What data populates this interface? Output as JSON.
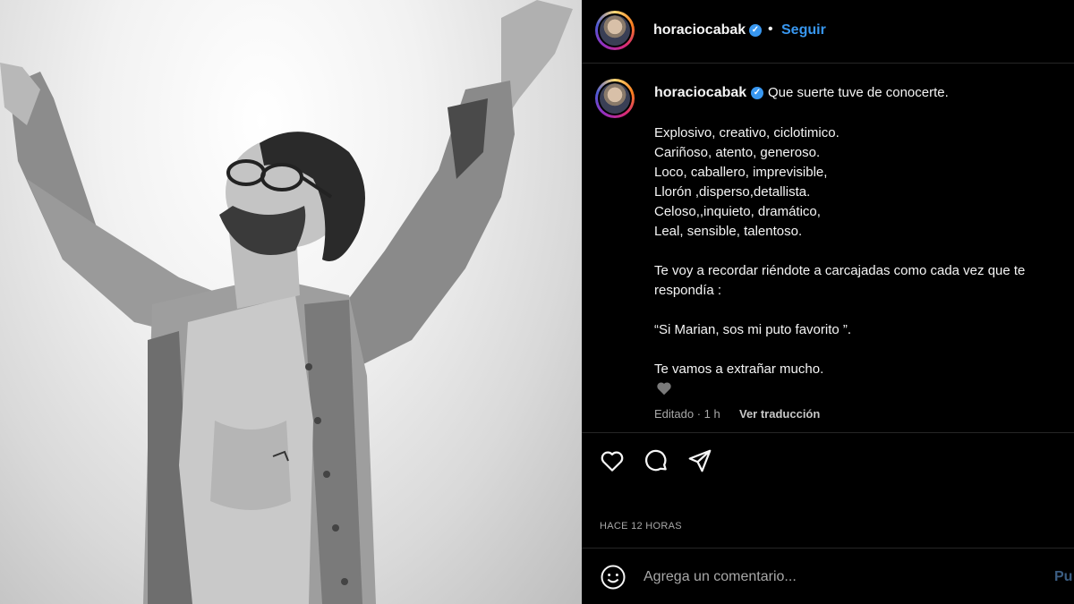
{
  "header": {
    "username": "horaciocabak",
    "dot": "•",
    "follow_label": "Seguir"
  },
  "caption": {
    "username": "horaciocabak",
    "first_line": "Que suerte tuve de conocerte.",
    "lines": [
      "Explosivo, creativo, ciclotimico.",
      "Cariñoso, atento, generoso.",
      "Loco, caballero, imprevisible,",
      "Llorón ,disperso,detallista.",
      "Celoso,,inquieto, dramático,",
      "Leal, sensible, talentoso.",
      "Te voy a recordar riéndote a carcajadas como cada vez que te",
      "respondía :",
      "“Si Marian, sos mi puto favorito ”.",
      "Te vamos a extrañar mucho."
    ],
    "edited": "Editado · 1 h",
    "see_translation": "Ver traducción"
  },
  "post": {
    "timestamp": "HACE 12 HORAS"
  },
  "comment": {
    "placeholder": "Agrega un comentario...",
    "publish_label": "Pu"
  },
  "colors": {
    "accent": "#3897f0",
    "background": "#000000",
    "text": "#f5f5f5",
    "muted": "#a8a8a8"
  },
  "icons": {
    "like": "heart-icon",
    "comment": "comment-icon",
    "share": "share-icon",
    "emoji": "emoji-icon",
    "verified": "verified-badge-icon",
    "caption_heart": "small-heart-icon"
  }
}
